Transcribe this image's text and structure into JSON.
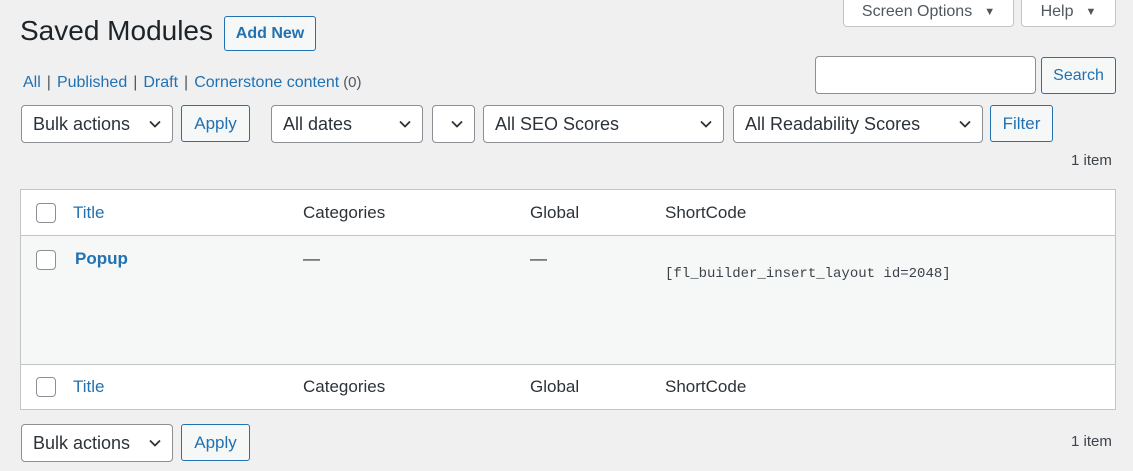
{
  "header": {
    "screen_options_label": "Screen Options",
    "help_label": "Help",
    "page_title": "Saved Modules",
    "add_new_label": "Add New"
  },
  "filters": {
    "views": [
      {
        "label": "All"
      },
      {
        "label": "Published"
      },
      {
        "label": "Draft"
      },
      {
        "label": "Cornerstone content"
      }
    ],
    "cornerstone_count": "(0)"
  },
  "search": {
    "value": "",
    "button_label": "Search"
  },
  "tablenav_top": {
    "bulk_actions": "Bulk actions",
    "apply_label": "Apply",
    "dates": "All dates",
    "extra_select": "",
    "seo_scores": "All SEO Scores",
    "readability_scores": "All Readability Scores",
    "filter_label": "Filter",
    "items_count": "1 item"
  },
  "table": {
    "columns": [
      "Title",
      "Categories",
      "Global",
      "ShortCode"
    ],
    "rows": [
      {
        "title": "Popup",
        "categories": "—",
        "global": "—",
        "shortcode": "[fl_builder_insert_layout id=2048]"
      }
    ]
  },
  "tablenav_bottom": {
    "bulk_actions": "Bulk actions",
    "apply_label": "Apply",
    "items_count": "1 item"
  },
  "colors": {
    "accent": "#2271b1",
    "background": "#f0f0f1"
  }
}
